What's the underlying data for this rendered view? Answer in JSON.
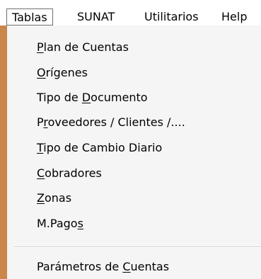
{
  "menubar": {
    "items": [
      {
        "label": "Tablas"
      },
      {
        "label": "SUNAT"
      },
      {
        "label": "Utilitarios"
      },
      {
        "label": "Help"
      }
    ]
  },
  "dropdown": {
    "items": [
      {
        "pre": "",
        "key": "P",
        "post": "lan de Cuentas"
      },
      {
        "pre": "",
        "key": "O",
        "post": "rígenes"
      },
      {
        "pre": "Tipo de ",
        "key": "D",
        "post": "ocumento"
      },
      {
        "pre": "P",
        "key": "r",
        "post": "oveedores / Clientes /...."
      },
      {
        "pre": "",
        "key": "T",
        "post": "ipo de Cambio Diario"
      },
      {
        "pre": "",
        "key": "C",
        "post": "obradores"
      },
      {
        "pre": "",
        "key": "Z",
        "post": "onas"
      },
      {
        "pre": "M.Pago",
        "key": "s",
        "post": ""
      },
      {
        "pre": "Parámetros de ",
        "key": "C",
        "post": "uentas"
      }
    ]
  }
}
